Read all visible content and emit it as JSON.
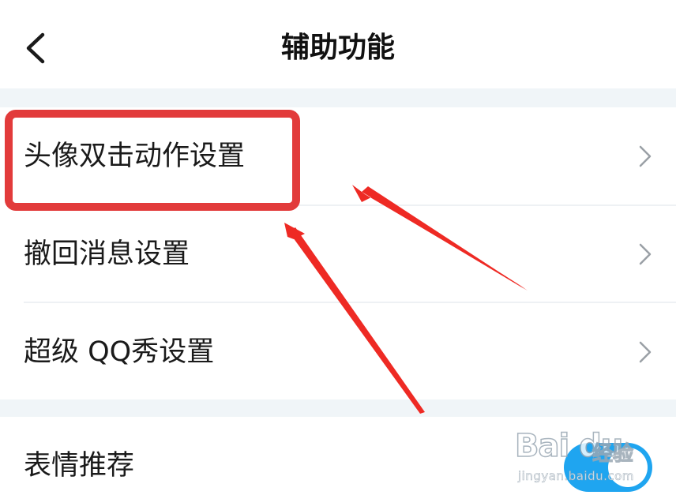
{
  "header": {
    "back_icon": "chevron-left-icon",
    "title": "辅助功能"
  },
  "settings_group": {
    "items": [
      {
        "label": "头像双击动作设置",
        "icon": "chevron-right-icon"
      },
      {
        "label": "撤回消息设置",
        "icon": "chevron-right-icon"
      },
      {
        "label": "超级 QQ秀设置",
        "icon": "chevron-right-icon"
      }
    ]
  },
  "emoji_recommend": {
    "label": "表情推荐",
    "toggle_on": true
  },
  "annotation": {
    "highlight_color": "#e23b3b",
    "arrow_color": "#ee2a24"
  },
  "watermark": {
    "logo": "Bai du",
    "sub": "经验",
    "url": "jingyan.baidu.com"
  },
  "colors": {
    "accent": "#1fa5f0",
    "background": "#f3f7fa"
  }
}
